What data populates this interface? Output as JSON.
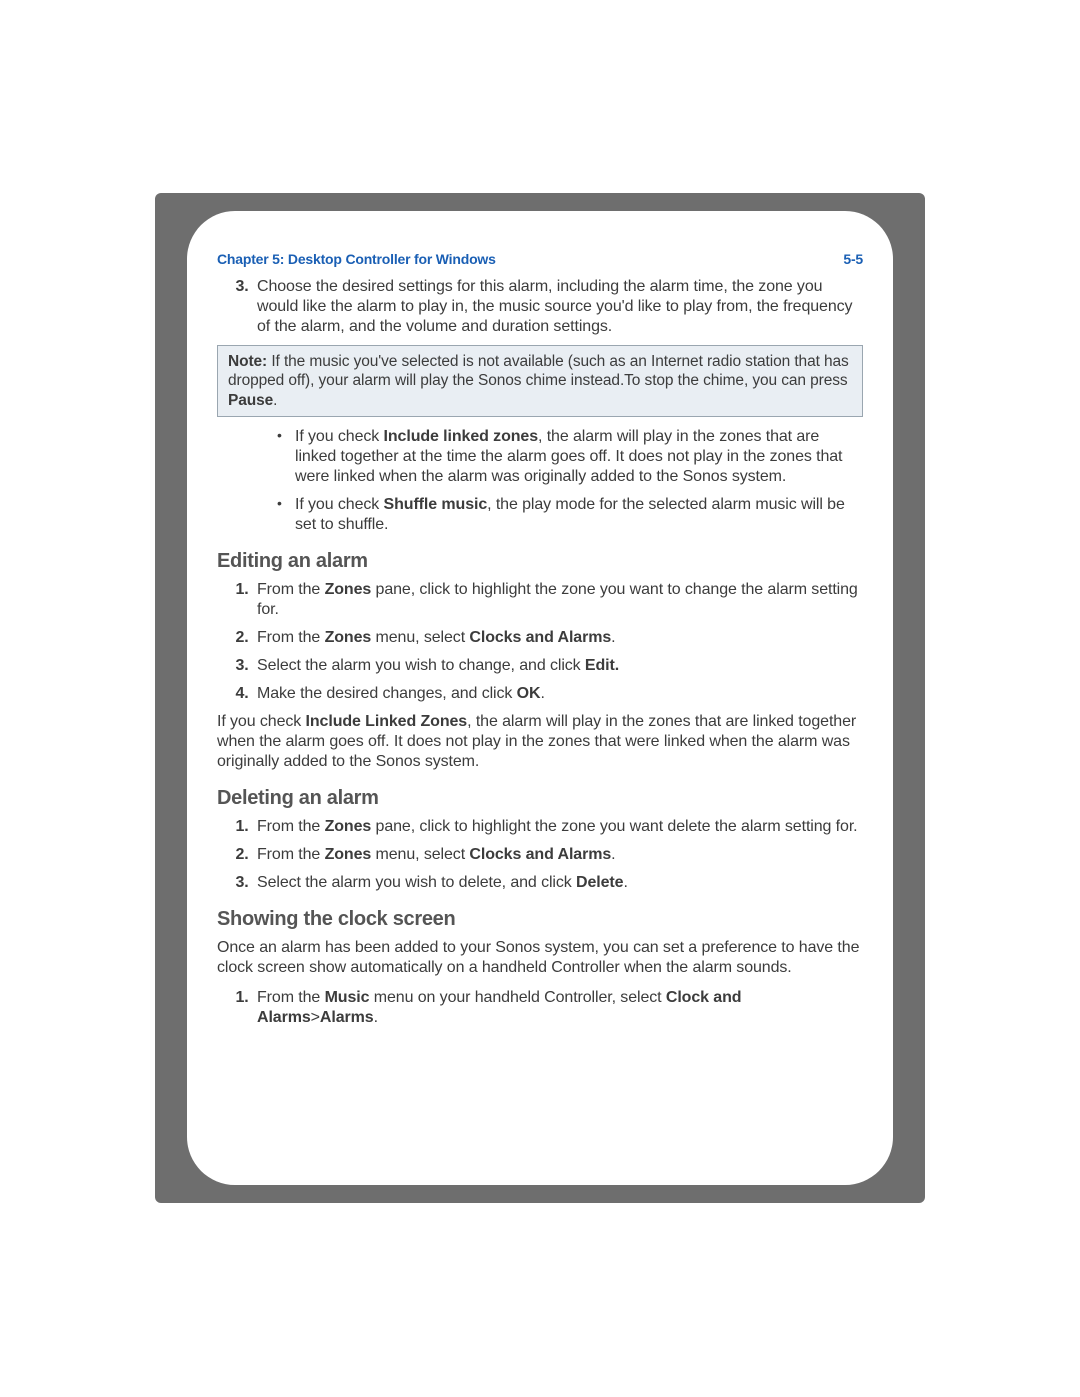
{
  "header": {
    "chapter": "Chapter 5:  Desktop Controller for Windows",
    "pagenum": "5-5"
  },
  "step3": {
    "text": "Choose the desired settings for this alarm, including the alarm time, the zone you would like the alarm to play in, the music source you'd like to play from, the frequency of the alarm, and the volume and duration settings."
  },
  "note": {
    "label": "Note:",
    "body_a": "If the music you've selected is not available (such as an Internet radio station that has dropped off), your alarm will play the Sonos chime instead.To stop the chime, you can press ",
    "bold_pause": "Pause",
    "body_b": "."
  },
  "bullets": {
    "b1_a": "If you check ",
    "b1_bold": "Include linked zones",
    "b1_b": ", the alarm will play in the zones that are linked together at the time the alarm goes off. It does not play in the zones that were linked when the alarm was originally added to the Sonos system.",
    "b2_a": "If you check ",
    "b2_bold": "Shuffle music",
    "b2_b": ", the play mode for the selected alarm music will be set to shuffle."
  },
  "editing": {
    "title": "Editing an alarm",
    "s1_a": "From the ",
    "s1_bold": "Zones",
    "s1_b": " pane, click to highlight the zone you want to change the alarm setting for.",
    "s2_a": "From the ",
    "s2_bold1": "Zones",
    "s2_b": " menu, select ",
    "s2_bold2": "Clocks and Alarms",
    "s2_c": ".",
    "s3_a": "Select the alarm you wish to change, and click ",
    "s3_bold": "Edit.",
    "s4_a": "Make the desired changes, and click ",
    "s4_bold": "OK",
    "s4_b": ".",
    "p_a": "If you check ",
    "p_bold": "Include Linked Zones",
    "p_b": ", the alarm will play in the zones that are linked together when the alarm goes off. It does not play in the zones that were linked when the alarm was originally added to the Sonos system."
  },
  "deleting": {
    "title": "Deleting an alarm",
    "s1_a": "From the ",
    "s1_bold": "Zones",
    "s1_b": " pane, click to highlight the zone you want delete the alarm setting for.",
    "s2_a": "From the ",
    "s2_bold1": "Zones",
    "s2_b": " menu, select ",
    "s2_bold2": "Clocks and Alarms",
    "s2_c": ".",
    "s3_a": "Select the alarm you wish to delete, and click ",
    "s3_bold": "Delete",
    "s3_b": "."
  },
  "clock": {
    "title": "Showing the clock screen",
    "intro": "Once an alarm has been added to your Sonos system, you can set a preference to have the clock screen show automatically on a handheld Controller when the alarm sounds.",
    "s1_a": "From the ",
    "s1_bold1": "Music",
    "s1_b": " menu on your handheld Controller, select ",
    "s1_bold2": "Clock and Alarms",
    "s1_c": ">",
    "s1_bold3": "Alarms",
    "s1_d": "."
  }
}
